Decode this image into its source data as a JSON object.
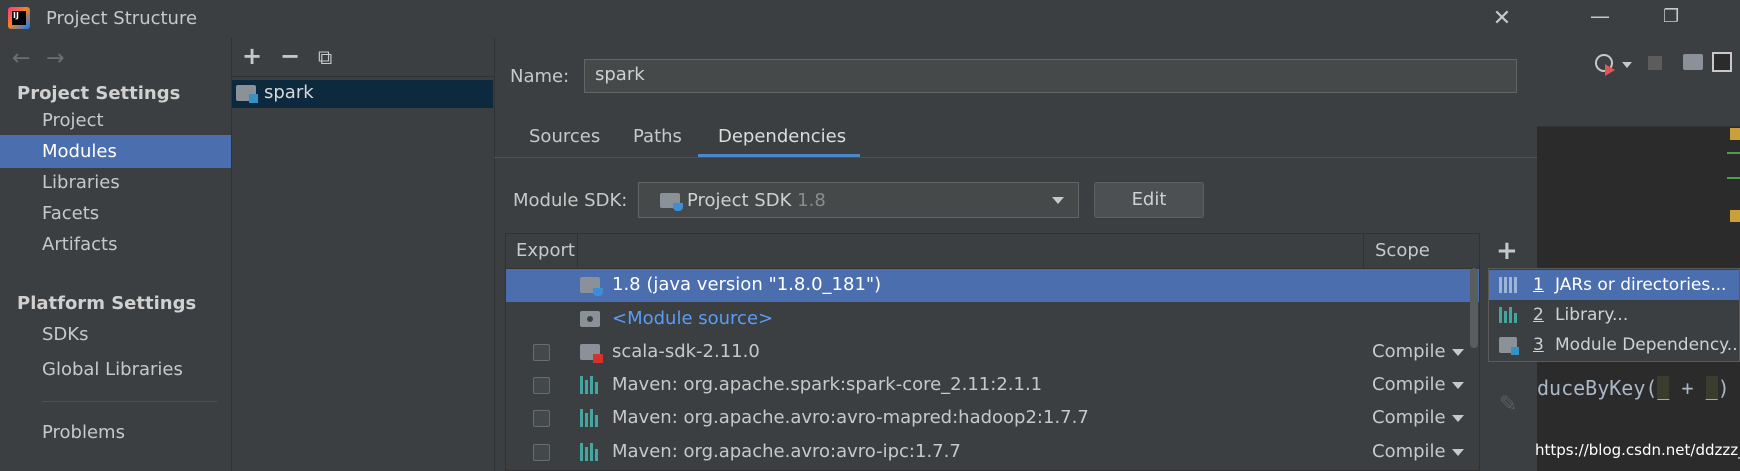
{
  "dialog": {
    "title": "Project Structure",
    "close_glyph": "✕"
  },
  "nav": {
    "back_glyph": "←",
    "forward_glyph": "→",
    "project_settings_header": "Project Settings",
    "platform_settings_header": "Platform Settings",
    "items": [
      {
        "label": "Project"
      },
      {
        "label": "Modules"
      },
      {
        "label": "Libraries"
      },
      {
        "label": "Facets"
      },
      {
        "label": "Artifacts"
      },
      {
        "label": "SDKs"
      },
      {
        "label": "Global Libraries"
      },
      {
        "label": "Problems"
      }
    ],
    "selected": "Modules"
  },
  "modules": {
    "add_glyph": "+",
    "remove_glyph": "−",
    "copy_glyph": "⧉",
    "list": [
      {
        "label": "spark"
      }
    ]
  },
  "module": {
    "name_label": "Name:",
    "name_value": "spark",
    "tabs": [
      {
        "label": "Sources"
      },
      {
        "label": "Paths"
      },
      {
        "label": "Dependencies"
      }
    ],
    "active_tab": "Dependencies",
    "sdk_label": "Module SDK:",
    "sdk_value": "Project SDK",
    "sdk_version": "1.8",
    "edit_button": "Edit"
  },
  "deps": {
    "col_export": "Export",
    "col_scope": "Scope",
    "rows": [
      {
        "text": "1.8 (java version \"1.8.0_181\")",
        "scope": "",
        "checkbox": false,
        "icon": "jdk-folder-icon"
      },
      {
        "text": "<Module source>",
        "scope": "",
        "checkbox": false,
        "icon": "source-folder-icon"
      },
      {
        "text": "scala-sdk-2.11.0",
        "scope": "Compile",
        "checkbox": true,
        "icon": "scala-sdk-icon"
      },
      {
        "text": "Maven: org.apache.spark:spark-core_2.11:2.1.1",
        "scope": "Compile",
        "checkbox": true,
        "icon": "maven-library-icon"
      },
      {
        "text": "Maven: org.apache.avro:avro-mapred:hadoop2:1.7.7",
        "scope": "Compile",
        "checkbox": true,
        "icon": "maven-library-icon"
      },
      {
        "text": "Maven: org.apache.avro:avro-ipc:1.7.7",
        "scope": "Compile",
        "checkbox": true,
        "icon": "maven-library-icon"
      }
    ],
    "add_glyph": "+",
    "edit_glyph": "✎"
  },
  "popup": {
    "items": [
      {
        "num": "1",
        "label": "JARs or directories..."
      },
      {
        "num": "2",
        "label": "Library..."
      },
      {
        "num": "3",
        "label": "Module Dependency..."
      }
    ]
  },
  "ide": {
    "minimize_glyph": "—",
    "restore_glyph": "❐",
    "code_prefix": "duceByKey(",
    "code_u1": "_",
    "code_mid": " + ",
    "code_u2": "_",
    "code_suffix": ")",
    "watermark": "https://blog.csdn.net/ddzzz_"
  },
  "colors": {
    "accent": "#4b6eaf",
    "link": "#589df6",
    "tab_underline": "#4a88c7",
    "library_icon": "#43a6a0"
  }
}
